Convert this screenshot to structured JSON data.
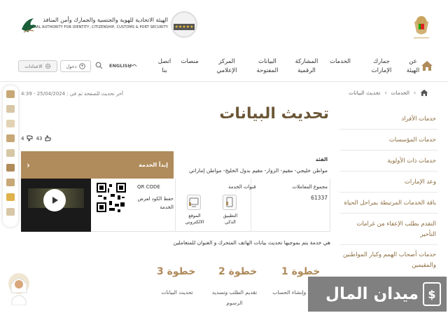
{
  "header": {
    "uae_emblem_caption": "United Arab Emirates",
    "authority_name_ar": "الهيئة الاتحادية للهوية والجنسية والجمارك وأمن المنافذ",
    "authority_name_en": "FEDERAL AUTHORITY FOR IDENTITY, CITIZENSHIP, CUSTOMS & PORT SECURITY",
    "stars_badge": "★★★★★"
  },
  "nav": {
    "items": [
      {
        "label": "عن\nالهيئة"
      },
      {
        "label": "جمارك\nالإمارات"
      },
      {
        "label": "الخدمات"
      },
      {
        "label": "المشاركة\nالرقمية"
      },
      {
        "label": "البيانات\nالمفتوحة"
      },
      {
        "label": "المركز\nالإعلامي"
      },
      {
        "label": "منصات"
      },
      {
        "label": "اتصل\nبنا"
      }
    ],
    "lang_label": "ENGLISH",
    "login_label": "دخول",
    "settings_label": "الاعدادات"
  },
  "breadcrumb": {
    "items": [
      "الخدمات",
      "تحديث البيانات"
    ]
  },
  "last_updated": "أخر تحديث للصفحة تم في : 25/04/2024 - 4:39",
  "sidebar": {
    "items": [
      "خدمات الأفراد",
      "خدمات المؤسسات",
      "خدمات ذات الأولوية",
      "وعد الإمارات",
      "باقة الخدمات المرتبطة بمراحل الحياة",
      "التقدم بطلب الإعفاء من غرامات التأخير",
      "خدمات أصحاب الهمم وكبار المواطنين والمقيمين"
    ]
  },
  "main": {
    "title": "تحديث البيانات",
    "likes": "43",
    "dislikes": "4",
    "category_label": "الفئة",
    "category_value": "مواطن خليجي- مقيم- الزوار- مقيم بدول الخليج- مواطن إماراتي",
    "start_button": "إبدأ الخدمة",
    "transactions_label": "مجموع المعاملات",
    "transactions_value": "61337",
    "channels_label": "قنوات الخدمة",
    "channel_app": "التطبيق\nالذكي",
    "channel_web": "الموقع\nالالكتروني",
    "qr_title": "QR CODE",
    "qr_desc": "حفظ الكود لعرض الخدمة",
    "description": "هي خدمة يتم بموجبها تحديث بيانات الهاتف المتحرك و العنوان للمتعاملين"
  },
  "steps": [
    {
      "title": "خطوة 1",
      "desc": "... وإنشاء الحساب"
    },
    {
      "title": "خطوة 2",
      "desc": "تقديم الطلب وتسديد\nالرسوم"
    },
    {
      "title": "خطوة 3",
      "desc": "تحديث البيانات"
    }
  ],
  "watermark": {
    "text": "ميدان المال",
    "logo_char": "$"
  },
  "colors": {
    "brand_gold": "#b08b5b",
    "title_brown": "#6b5636",
    "sidebar_link": "#8a6a3c"
  }
}
